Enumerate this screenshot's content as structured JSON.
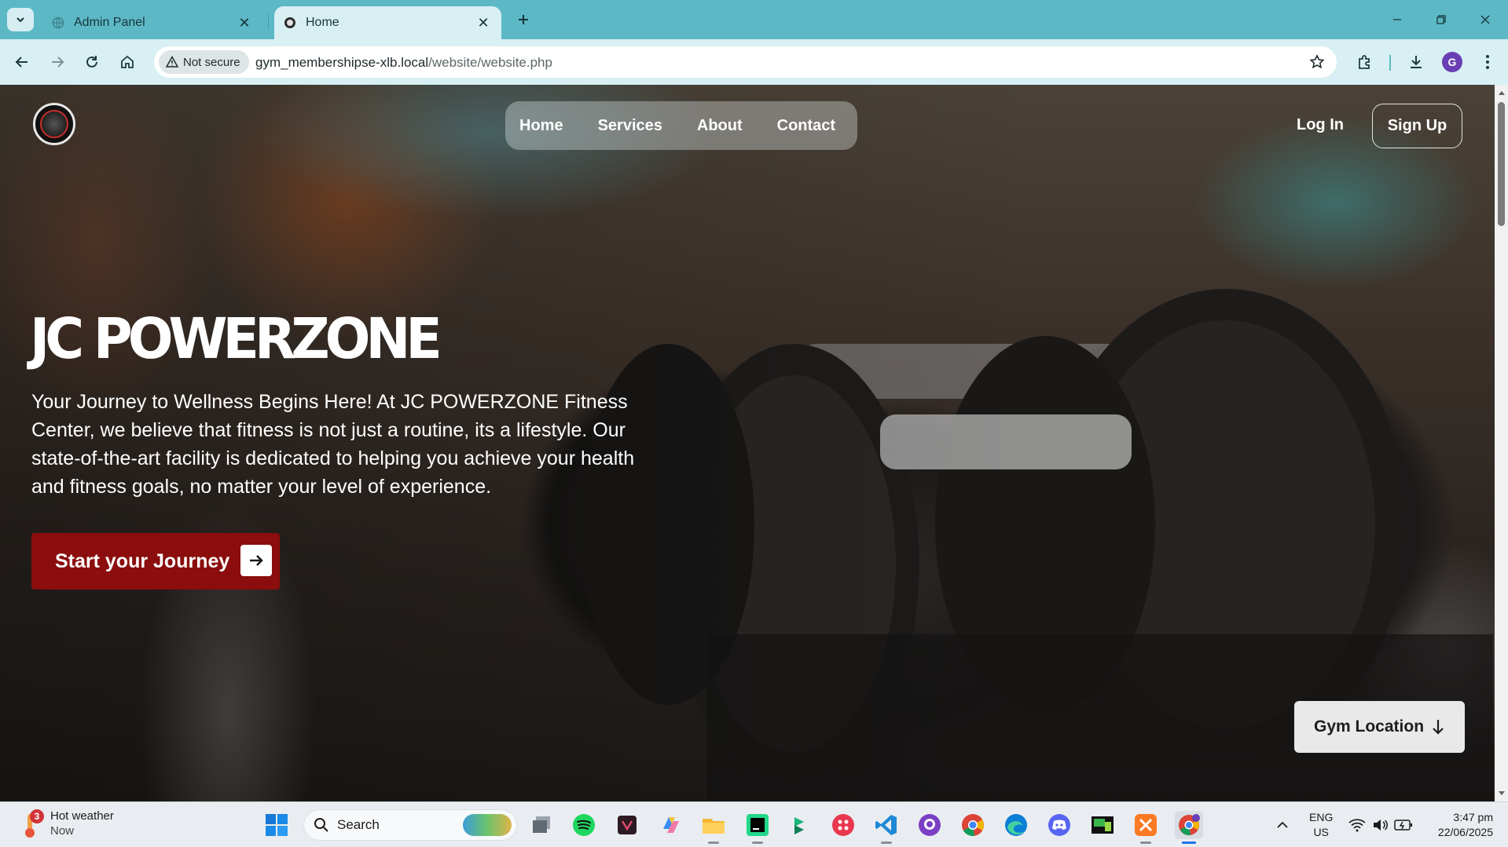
{
  "browser": {
    "tabs": [
      {
        "title": "Admin Panel",
        "active": false
      },
      {
        "title": "Home",
        "active": true
      }
    ],
    "security_label": "Not secure",
    "url_host": "gym_membershipse-xlb.local",
    "url_path": "/website/website.php",
    "profile_initial": "G"
  },
  "site": {
    "nav": {
      "home": "Home",
      "services": "Services",
      "about": "About",
      "contact": "Contact"
    },
    "login_label": "Log In",
    "signup_label": "Sign Up",
    "hero_title": "JC POWERZONE",
    "hero_text": "Your Journey to Wellness Begins Here! At JC POWERZONE Fitness Center, we believe that fitness is not just a routine, its a lifestyle. Our state-of-the-art facility is dedicated to helping you achieve your health and fitness goals, no matter your level of experience.",
    "cta_label": "Start your Journey",
    "gym_location_label": "Gym Location",
    "accent_color": "#8b0d0d"
  },
  "taskbar": {
    "weather_title": "Hot weather",
    "weather_sub": "Now",
    "weather_badge": "3",
    "search_label": "Search",
    "lang_primary": "ENG",
    "lang_secondary": "US",
    "time": "3:47 pm",
    "date": "22/06/2025",
    "apps": [
      "start-icon",
      "task-view-icon",
      "spotify-icon",
      "app-icon",
      "copilot-icon",
      "file-explorer-icon",
      "pycharm-icon",
      "app-icon",
      "app-icon",
      "vscode-icon",
      "github-desktop-icon",
      "chrome-icon",
      "edge-icon",
      "discord-icon",
      "app-icon",
      "xampp-icon",
      "chrome-profile-icon"
    ]
  }
}
